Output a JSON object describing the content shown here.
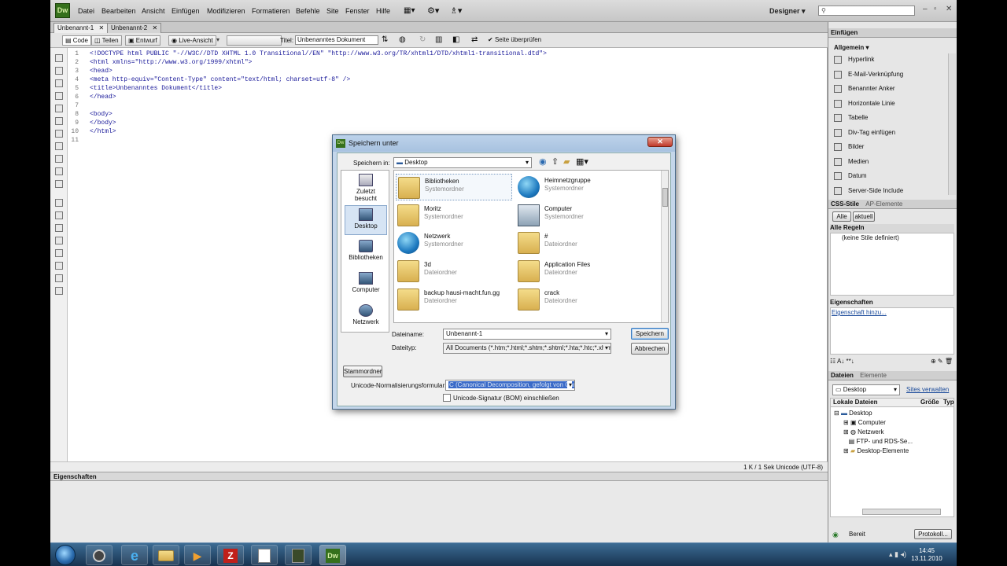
{
  "app": {
    "logo": "Dw",
    "designer_label": "Designer ▾"
  },
  "menu": [
    "Datei",
    "Bearbeiten",
    "Ansicht",
    "Einfügen",
    "Modifizieren",
    "Formatieren",
    "Befehle",
    "Site",
    "Fenster",
    "Hilfe"
  ],
  "doc_tabs": [
    "Unbenannt-1",
    "Unbenannt-2"
  ],
  "doc_toolbar": {
    "code": "Code",
    "split": "Teilen",
    "design": "Entwurf",
    "live": "Live-Ansicht",
    "title_label": "Titel:",
    "title_value": "Unbenanntes Dokument",
    "check_page": "Seite überprüfen"
  },
  "code": {
    "line_numbers": [
      "1",
      "2",
      "3",
      "4",
      "5",
      "6",
      "7",
      "8",
      "9",
      "10",
      "11"
    ],
    "lines": [
      "<!DOCTYPE html PUBLIC \"-//W3C//DTD XHTML 1.0 Transitional//EN\" \"http://www.w3.org/TR/xhtml1/DTD/xhtml1-transitional.dtd\">",
      "<html xmlns=\"http://www.w3.org/1999/xhtml\">",
      "<head>",
      "<meta http-equiv=\"Content-Type\" content=\"text/html; charset=utf-8\" />",
      "<title>Unbenanntes Dokument</title>",
      "</head>",
      "",
      "<body>",
      "</body>",
      "</html>",
      ""
    ]
  },
  "status": {
    "right": "1 K / 1 Sek  Unicode (UTF-8)"
  },
  "properties_panel": {
    "title": "Eigenschaften"
  },
  "insert_panel": {
    "tab": "Einfügen",
    "category": "Allgemein ▾",
    "items": [
      "Hyperlink",
      "E-Mail-Verknüpfung",
      "Benannter Anker",
      "Horizontale Linie",
      "Tabelle",
      "Div-Tag einfügen",
      "Bilder",
      "Medien",
      "Datum",
      "Server-Side Include"
    ]
  },
  "css_panel": {
    "tabs": [
      "CSS-Stile",
      "AP-Elemente"
    ],
    "mode_buttons": [
      "Alle",
      "aktuell"
    ],
    "rules_header": "Alle Regeln",
    "rules_empty": "(keine Stile definiert)",
    "props_header": "Eigenschaften",
    "add_prop": "Eigenschaft hinzu..."
  },
  "files_panel": {
    "tabs": [
      "Dateien",
      "Elemente"
    ],
    "site_select": "Desktop",
    "manage_sites": "Sites verwalten",
    "columns": [
      "Lokale Dateien",
      "Größe",
      "Typ"
    ],
    "tree": [
      "Desktop",
      "Computer",
      "Netzwerk",
      "FTP- und RDS-Se...",
      "Desktop-Elemente"
    ],
    "status": "Bereit",
    "log_button": "Protokoll..."
  },
  "dialog": {
    "title": "Speichern unter",
    "save_in_label": "Speichern in:",
    "save_in_value": "Desktop",
    "places": [
      "Zuletzt besucht",
      "Desktop",
      "Bibliotheken",
      "Computer",
      "Netzwerk"
    ],
    "files": [
      {
        "name": "Bibliotheken",
        "type": "Systemordner",
        "icon": "libraries-icon"
      },
      {
        "name": "Heimnetzgruppe",
        "type": "Systemordner",
        "icon": "homegroup-icon"
      },
      {
        "name": "Moritz",
        "type": "Systemordner",
        "icon": "user-folder-icon"
      },
      {
        "name": "Computer",
        "type": "Systemordner",
        "icon": "computer-icon"
      },
      {
        "name": "Netzwerk",
        "type": "Systemordner",
        "icon": "network-icon"
      },
      {
        "name": "#",
        "type": "Dateiordner",
        "icon": "folder-icon"
      },
      {
        "name": "3d",
        "type": "Dateiordner",
        "icon": "folder-icon"
      },
      {
        "name": "Application Files",
        "type": "Dateiordner",
        "icon": "folder-icon"
      },
      {
        "name": "backup hausi-macht.fun.gg",
        "type": "Dateiordner",
        "icon": "folder-icon"
      },
      {
        "name": "crack",
        "type": "Dateiordner",
        "icon": "folder-icon"
      }
    ],
    "filename_label": "Dateiname:",
    "filename_value": "Unbenannt-1",
    "filetype_label": "Dateityp:",
    "filetype_value": "All Documents (*.htm;*.html;*.shtm;*.shtml;*.hta;*.htc;*.xhtml;*.",
    "save_button": "Speichern",
    "cancel_button": "Abbrechen",
    "site_root_button": "Stammordner",
    "unicode_label": "Unicode-Normalisierungsformular:",
    "unicode_value": "C (Canonical Decomposition, gefolgt von Cano",
    "bom_label": "Unicode-Signatur (BOM) einschließen"
  },
  "taskbar": {
    "time": "14:45",
    "date": "13.11.2010",
    "dw_label": "Dw"
  }
}
